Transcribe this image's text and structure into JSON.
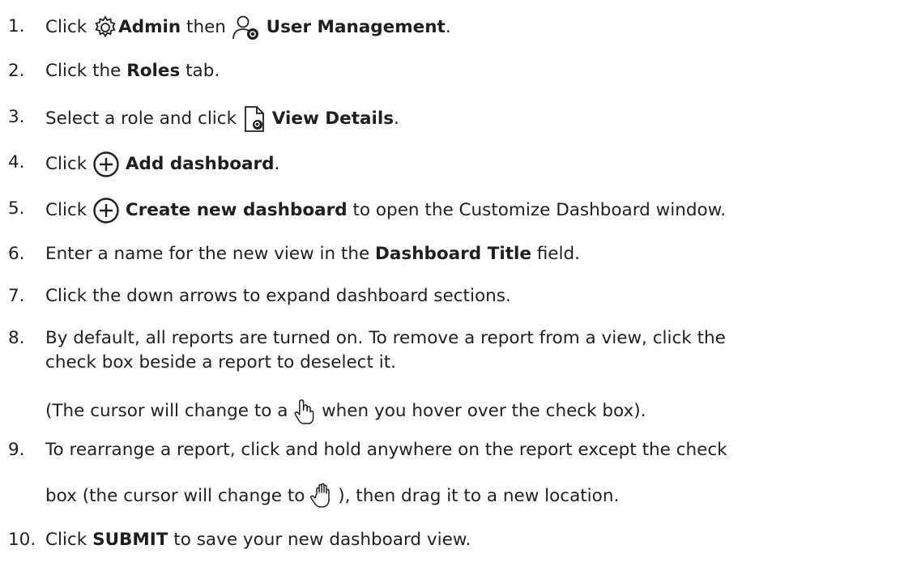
{
  "steps": [
    {
      "num": "1.",
      "t0": "Click ",
      "b0": "Admin",
      "t1": " then ",
      "b1": "User Management",
      "t2": ".",
      "icon0": "gear-icon",
      "icon1": "user-settings-icon"
    },
    {
      "num": "2.",
      "t0": "Click the ",
      "b0": "Roles",
      "t1": " tab."
    },
    {
      "num": "3.",
      "t0": "Select a role and click ",
      "b0": "View Details",
      "t1": ".",
      "icon0": "document-search-icon"
    },
    {
      "num": "4.",
      "t0": "Click ",
      "b0": "Add dashboard",
      "t1": ".",
      "icon0": "plus-circle-icon"
    },
    {
      "num": "5.",
      "t0": "Click ",
      "b0": "Create new dashboard",
      "t1": " to open the Customize Dashboard window.",
      "icon0": "plus-circle-icon"
    },
    {
      "num": "6.",
      "t0": "Enter a name for the new view in the ",
      "b0": "Dashboard Title",
      "t1": " field."
    },
    {
      "num": "7.",
      "t0": "Click the down arrows to expand dashboard sections."
    },
    {
      "num": "8.",
      "t0": "By default, all reports are turned on. To remove a report from a view, click the",
      "t0b": "check box beside a report to deselect it.",
      "t1": "(The cursor will change to a ",
      "t2": " when you hover over the check box).",
      "icon0": "pointer-hand-icon"
    },
    {
      "num": "9.",
      "t0": "To rearrange a report, click and hold anywhere on the report except the check",
      "t1": "box (the cursor will change to ",
      "t2": "), then drag it to a new location.",
      "icon0": "grab-hand-icon"
    },
    {
      "num": "10.",
      "t0": "Click ",
      "b0": "SUBMIT",
      "t1": " to save your new dashboard view."
    }
  ]
}
